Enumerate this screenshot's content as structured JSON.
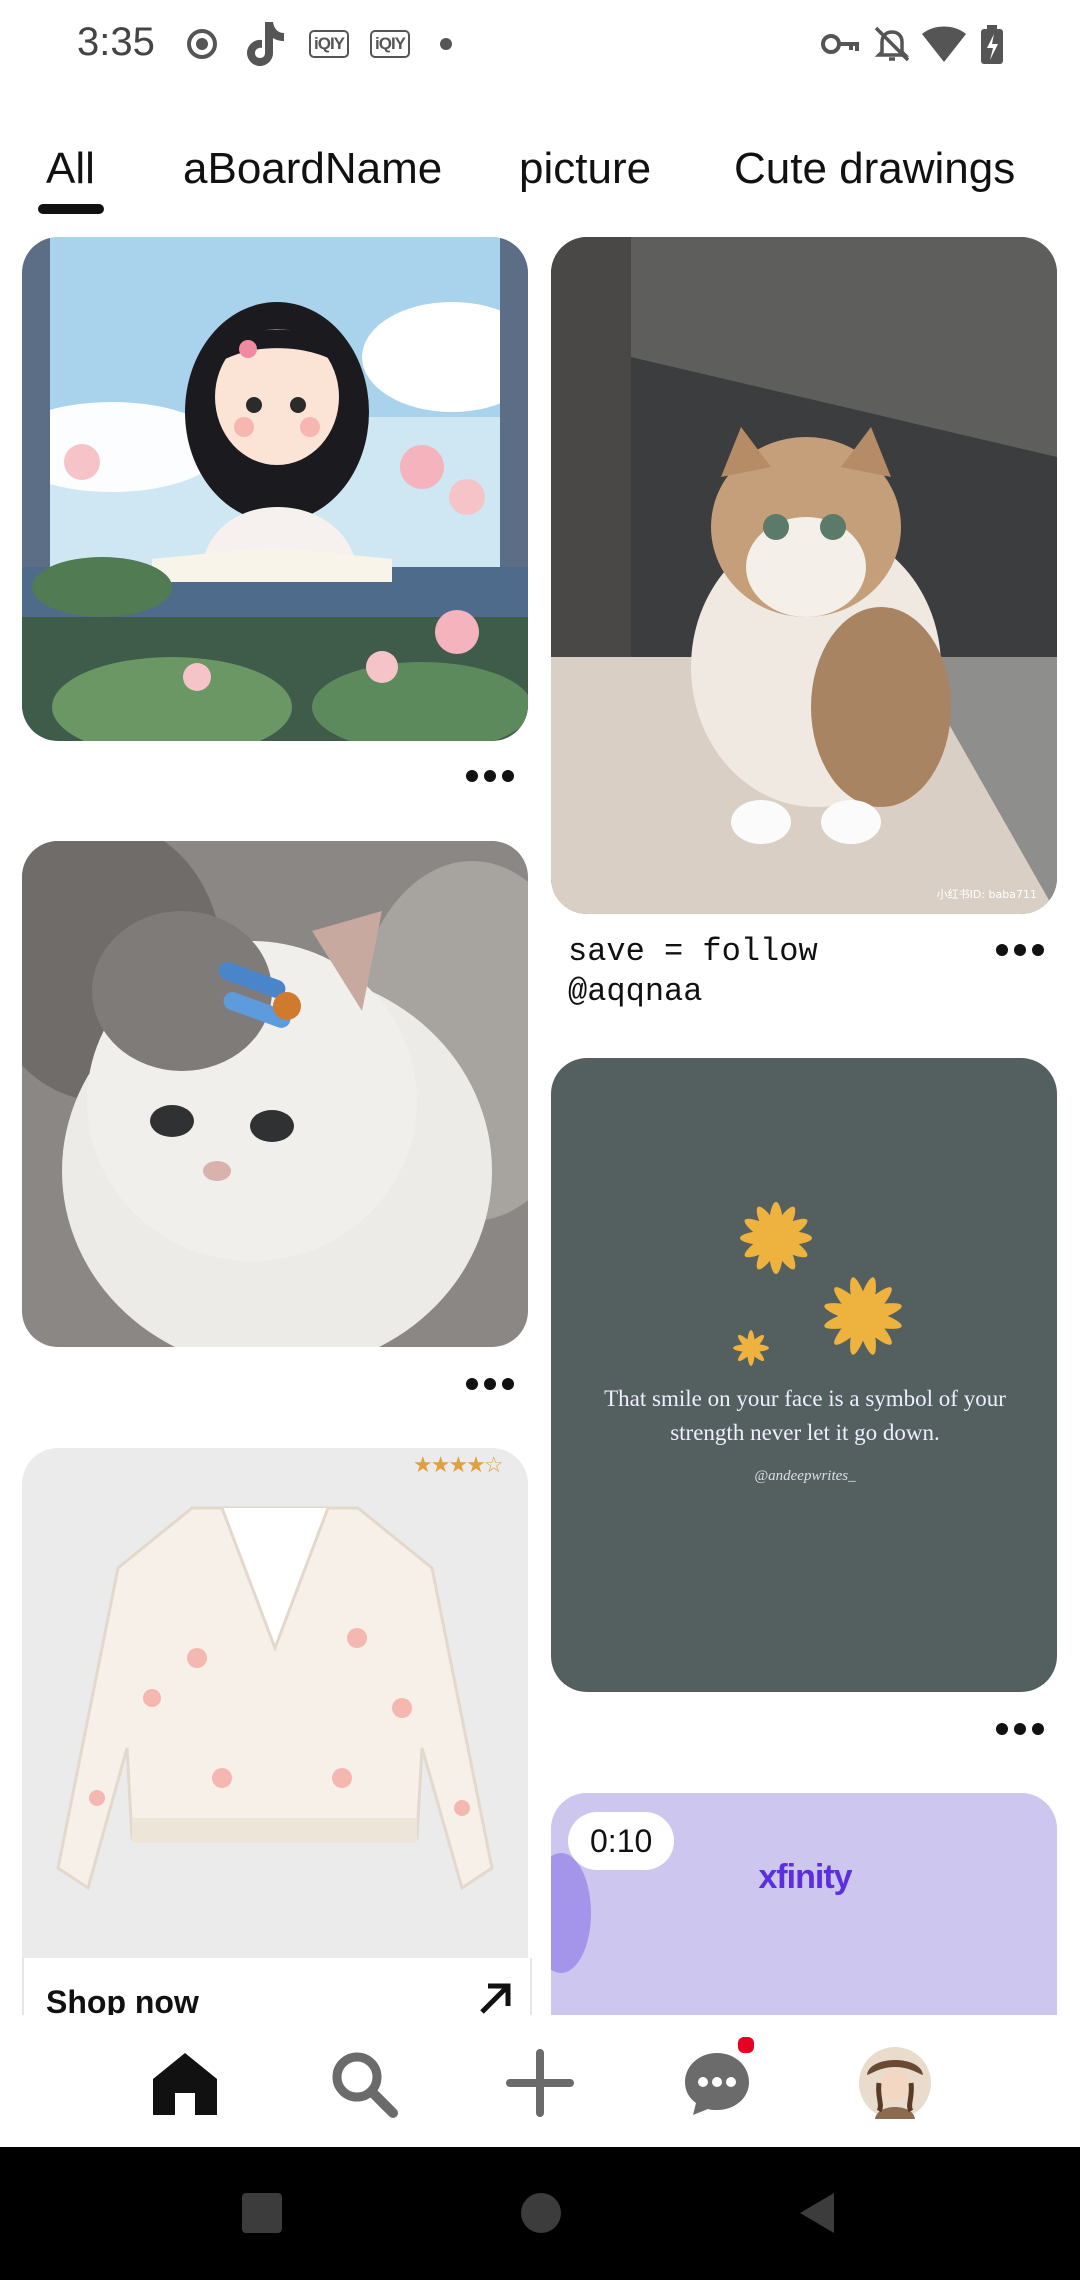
{
  "status_bar": {
    "time": "3:35",
    "left_icons": [
      "record-icon",
      "tiktok-icon",
      "iqiyi-icon",
      "iqiyi-icon",
      "dot-icon"
    ],
    "iqiyi_label": "iQIY",
    "right_icons": [
      "vpn-key-icon",
      "bell-off-icon",
      "wifi-icon",
      "battery-charging-icon"
    ]
  },
  "tabs": [
    {
      "label": "All",
      "selected": true
    },
    {
      "label": "aBoardName",
      "selected": false
    },
    {
      "label": "picture",
      "selected": false
    },
    {
      "label": "Cute drawings",
      "selected": false
    }
  ],
  "pins": {
    "girl_illustration": {
      "icon": "illustration-girl-reading"
    },
    "cat_photo": {
      "caption": "save = follow @aqqnaa",
      "watermark": "小红书ID: baba711"
    },
    "kitten_photo": {
      "icon": "kitten-photo"
    },
    "quote_card": {
      "quote": "That smile on your face is a symbol of your strength never let it go down.",
      "handle": "@andeepwrites_"
    },
    "cardigan_ad": {
      "rating_stars": 4.5,
      "cta_label": "Shop now"
    },
    "video_ad": {
      "duration": "0:10",
      "brand": "xfinity"
    }
  },
  "bottom_nav": {
    "items": [
      "home-icon",
      "search-icon",
      "create-plus-icon",
      "messages-icon",
      "profile-avatar"
    ],
    "active": "home-icon",
    "has_notification": true
  },
  "colors": {
    "accent_red": "#e60023",
    "quote_bg": "#53605f",
    "ad_bg": "#cfc8ec",
    "xfinity_purple": "#5b2ee0"
  }
}
